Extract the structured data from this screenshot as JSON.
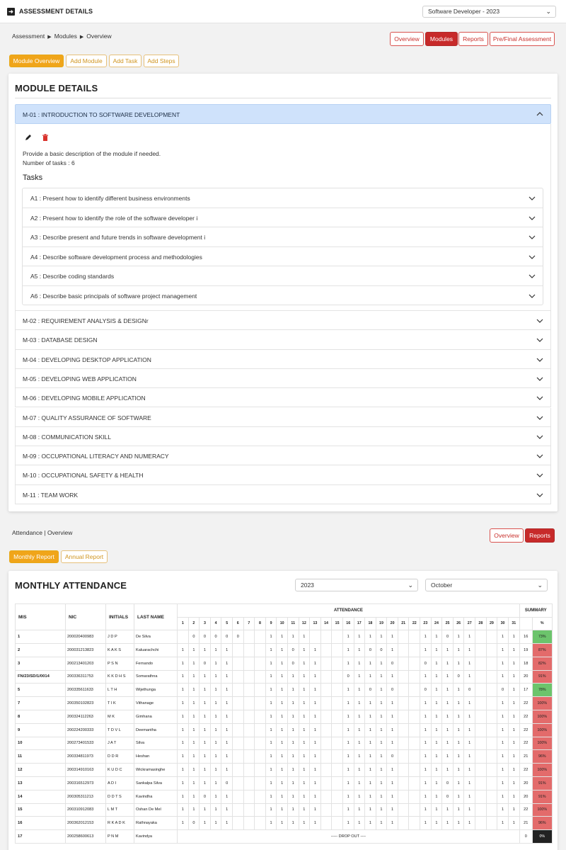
{
  "topbar": {
    "title": "ASSESSMENT DETAILS",
    "course_select": "Software Developer - 2023"
  },
  "breadcrumb": {
    "items": [
      "Assessment",
      "Modules",
      "Overview"
    ]
  },
  "nav_buttons": {
    "overview": "Overview",
    "modules": "Modules",
    "reports": "Reports",
    "pre_final": "Pre/Final Assessment"
  },
  "module_tabs": {
    "overview": "Module Overview",
    "add_module": "Add Module",
    "add_task": "Add Task",
    "add_steps": "Add Steps"
  },
  "module_details": {
    "title": "MODULE DETAILS",
    "open_module": {
      "label": "M-01 : INTRODUCTION TO SOFTWARE DEVELOPMENT",
      "description": "Provide a basic description of the module if needed.",
      "task_count": "Number of tasks : 6",
      "tasks_heading": "Tasks",
      "tasks": [
        "A1 : Present how to identify different business environments",
        "A2 : Present how to identify the role of the software developer i",
        "A3 : Describe present and future trends in software development i",
        "A4 : Describe software development process and methodologies",
        "A5 : Describe coding standards",
        "A6 : Describe basic principals of software project management"
      ]
    },
    "modules": [
      "M-02 : REQUIREMENT ANALYSIS & DESIGNr",
      "M-03 : DATABASE DESIGN",
      "M-04 : DEVELOPING DESKTOP APPLICATION",
      "M-05 : DEVELOPING WEB APPLICATION",
      "M-06 : DEVELOPING MOBILE APPLICATION",
      "M-07 : QUALITY ASSURANCE OF SOFTWARE",
      "M-08 : COMMUNICATION SKILL",
      "M-09 : OCCUPATIONAL LITERACY AND NUMERACY",
      "M-10 : OCCUPATIONAL SAFETY & HEALTH",
      "M-11 : TEAM WORK"
    ]
  },
  "attendance": {
    "breadcrumb": "Attendance | Overview",
    "buttons": {
      "overview": "Overview",
      "reports": "Reports"
    },
    "tabs": {
      "monthly": "Monthly Report",
      "annual": "Annual Report"
    },
    "title": "MONTHLY ATTENDANCE",
    "year": "2023",
    "month": "October",
    "headers": {
      "mis": "MIS",
      "nic": "NIC",
      "initials": "INITIALS",
      "last_name": "LAST NAME",
      "attendance": "ATTENDANCE",
      "summary": "SUMMARY",
      "percent": "%"
    },
    "days": [
      "1",
      "2",
      "3",
      "4",
      "5",
      "6",
      "7",
      "8",
      "9",
      "10",
      "11",
      "12",
      "13",
      "14",
      "15",
      "16",
      "17",
      "18",
      "19",
      "20",
      "21",
      "22",
      "23",
      "24",
      "25",
      "26",
      "27",
      "28",
      "29",
      "30",
      "31"
    ],
    "colors": {
      "green": "#6cc46c",
      "red": "#e36b6b",
      "black": "#222222"
    },
    "rows": [
      {
        "mis": "1",
        "nic": "200020400983",
        "initials": "J D P",
        "last": "De Silva",
        "days": [
          "",
          "0",
          "0",
          "0",
          "0",
          "0",
          "",
          "",
          "1",
          "1",
          "1",
          "1",
          "",
          "",
          "",
          "1",
          "1",
          "1",
          "1",
          "1",
          "",
          "",
          "1",
          "1",
          "0",
          "1",
          "1",
          "",
          "",
          "1",
          "1"
        ],
        "total": "16",
        "pct": "73%",
        "color": "green"
      },
      {
        "mis": "2",
        "nic": "200031213823",
        "initials": "K A K S",
        "last": "Kaluarachchi",
        "days": [
          "1",
          "1",
          "1",
          "1",
          "1",
          "",
          "",
          "",
          "1",
          "1",
          "0",
          "1",
          "1",
          "",
          "",
          "1",
          "1",
          "0",
          "0",
          "1",
          "",
          "",
          "1",
          "1",
          "1",
          "1",
          "1",
          "",
          "",
          "1",
          "1"
        ],
        "total": "19",
        "pct": "87%",
        "color": "red"
      },
      {
        "mis": "3",
        "nic": "200213401203",
        "initials": "P S N",
        "last": "Fernando",
        "days": [
          "1",
          "1",
          "0",
          "1",
          "1",
          "",
          "",
          "",
          "1",
          "1",
          "0",
          "1",
          "1",
          "",
          "",
          "1",
          "1",
          "1",
          "1",
          "0",
          "",
          "",
          "0",
          "1",
          "1",
          "1",
          "1",
          "",
          "",
          "1",
          "1"
        ],
        "total": "18",
        "pct": "82%",
        "color": "red"
      },
      {
        "mis": "FN/23/SD/1/0014",
        "nic": "200336311753",
        "initials": "K K D H S",
        "last": "Somarathna",
        "days": [
          "1",
          "1",
          "1",
          "1",
          "1",
          "",
          "",
          "",
          "1",
          "1",
          "1",
          "1",
          "1",
          "",
          "",
          "0",
          "1",
          "1",
          "1",
          "1",
          "",
          "",
          "1",
          "1",
          "1",
          "0",
          "1",
          "",
          "",
          "1",
          "1"
        ],
        "total": "20",
        "pct": "91%",
        "color": "red"
      },
      {
        "mis": "5",
        "nic": "200335611633",
        "initials": "L T H",
        "last": "Wijethunga",
        "days": [
          "1",
          "1",
          "1",
          "1",
          "1",
          "",
          "",
          "",
          "1",
          "1",
          "1",
          "1",
          "1",
          "",
          "",
          "1",
          "1",
          "0",
          "1",
          "0",
          "",
          "",
          "0",
          "1",
          "1",
          "1",
          "0",
          "",
          "",
          "0",
          "1"
        ],
        "total": "17",
        "pct": "78%",
        "color": "green"
      },
      {
        "mis": "7",
        "nic": "200350102823",
        "initials": "T I K",
        "last": "Vithanage",
        "days": [
          "1",
          "1",
          "1",
          "1",
          "1",
          "",
          "",
          "",
          "1",
          "1",
          "1",
          "1",
          "1",
          "",
          "",
          "1",
          "1",
          "1",
          "1",
          "1",
          "",
          "",
          "1",
          "1",
          "1",
          "1",
          "1",
          "",
          "",
          "1",
          "1"
        ],
        "total": "22",
        "pct": "100%",
        "color": "red"
      },
      {
        "mis": "8",
        "nic": "200324112263",
        "initials": "M K",
        "last": "Gimhana",
        "days": [
          "1",
          "1",
          "1",
          "1",
          "1",
          "",
          "",
          "",
          "1",
          "1",
          "1",
          "1",
          "1",
          "",
          "",
          "1",
          "1",
          "1",
          "1",
          "1",
          "",
          "",
          "1",
          "1",
          "1",
          "1",
          "1",
          "",
          "",
          "1",
          "1"
        ],
        "total": "22",
        "pct": "100%",
        "color": "red"
      },
      {
        "mis": "9",
        "nic": "200224200333",
        "initials": "T D V L",
        "last": "Deemantha",
        "days": [
          "1",
          "1",
          "1",
          "1",
          "1",
          "",
          "",
          "",
          "1",
          "1",
          "1",
          "1",
          "1",
          "",
          "",
          "1",
          "1",
          "1",
          "1",
          "1",
          "",
          "",
          "1",
          "1",
          "1",
          "1",
          "1",
          "",
          "",
          "1",
          "1"
        ],
        "total": "22",
        "pct": "100%",
        "color": "red"
      },
      {
        "mis": "10",
        "nic": "200273401533",
        "initials": "J A T",
        "last": "Silva",
        "days": [
          "1",
          "1",
          "1",
          "1",
          "1",
          "",
          "",
          "",
          "1",
          "1",
          "1",
          "1",
          "1",
          "",
          "",
          "1",
          "1",
          "1",
          "1",
          "1",
          "",
          "",
          "1",
          "1",
          "1",
          "1",
          "1",
          "",
          "",
          "1",
          "1"
        ],
        "total": "22",
        "pct": "100%",
        "color": "red"
      },
      {
        "mis": "11",
        "nic": "200334811973",
        "initials": "D D R",
        "last": "Heshan",
        "days": [
          "1",
          "1",
          "1",
          "1",
          "1",
          "",
          "",
          "",
          "1",
          "1",
          "1",
          "1",
          "1",
          "",
          "",
          "1",
          "1",
          "1",
          "1",
          "0",
          "",
          "",
          "1",
          "1",
          "1",
          "1",
          "1",
          "",
          "",
          "1",
          "1"
        ],
        "total": "21",
        "pct": "96%",
        "color": "red"
      },
      {
        "mis": "12",
        "nic": "200314910163",
        "initials": "K U D C",
        "last": "Wickramasinghe",
        "days": [
          "1",
          "1",
          "1",
          "1",
          "1",
          "",
          "",
          "",
          "1",
          "1",
          "1",
          "1",
          "1",
          "",
          "",
          "1",
          "1",
          "1",
          "1",
          "1",
          "",
          "",
          "1",
          "1",
          "1",
          "1",
          "1",
          "",
          "",
          "1",
          "1"
        ],
        "total": "22",
        "pct": "100%",
        "color": "red"
      },
      {
        "mis": "13",
        "nic": "200316512973",
        "initials": "A D I",
        "last": "Sankalpa Silva",
        "days": [
          "1",
          "1",
          "1",
          "1",
          "0",
          "",
          "",
          "",
          "1",
          "1",
          "1",
          "1",
          "1",
          "",
          "",
          "1",
          "1",
          "1",
          "1",
          "1",
          "",
          "",
          "1",
          "1",
          "0",
          "1",
          "1",
          "",
          "",
          "1",
          "1"
        ],
        "total": "20",
        "pct": "91%",
        "color": "red"
      },
      {
        "mis": "14",
        "nic": "200305311213",
        "initials": "D D T S",
        "last": "Kavindha",
        "days": [
          "1",
          "1",
          "0",
          "1",
          "1",
          "",
          "",
          "",
          "1",
          "1",
          "1",
          "1",
          "1",
          "",
          "",
          "1",
          "1",
          "1",
          "1",
          "1",
          "",
          "",
          "1",
          "1",
          "0",
          "1",
          "1",
          "",
          "",
          "1",
          "1"
        ],
        "total": "20",
        "pct": "91%",
        "color": "red"
      },
      {
        "mis": "15",
        "nic": "200310912083",
        "initials": "L M T",
        "last": "Oshan De Mel",
        "days": [
          "1",
          "1",
          "1",
          "1",
          "1",
          "",
          "",
          "",
          "1",
          "1",
          "1",
          "1",
          "1",
          "",
          "",
          "1",
          "1",
          "1",
          "1",
          "1",
          "",
          "",
          "1",
          "1",
          "1",
          "1",
          "1",
          "",
          "",
          "1",
          "1"
        ],
        "total": "22",
        "pct": "100%",
        "color": "red"
      },
      {
        "mis": "16",
        "nic": "200362012153",
        "initials": "R K A D K",
        "last": "Rathnayaka",
        "days": [
          "1",
          "0",
          "1",
          "1",
          "1",
          "",
          "",
          "",
          "1",
          "1",
          "1",
          "1",
          "1",
          "",
          "",
          "1",
          "1",
          "1",
          "1",
          "1",
          "",
          "",
          "1",
          "1",
          "1",
          "1",
          "1",
          "",
          "",
          "1",
          "1"
        ],
        "total": "21",
        "pct": "96%",
        "color": "red"
      },
      {
        "mis": "17",
        "nic": "200258600613",
        "initials": "P N M",
        "last": "Kavindya",
        "dropout": "----- DROP OUT ----",
        "total": "0",
        "pct": "0%",
        "color": "black"
      }
    ]
  }
}
